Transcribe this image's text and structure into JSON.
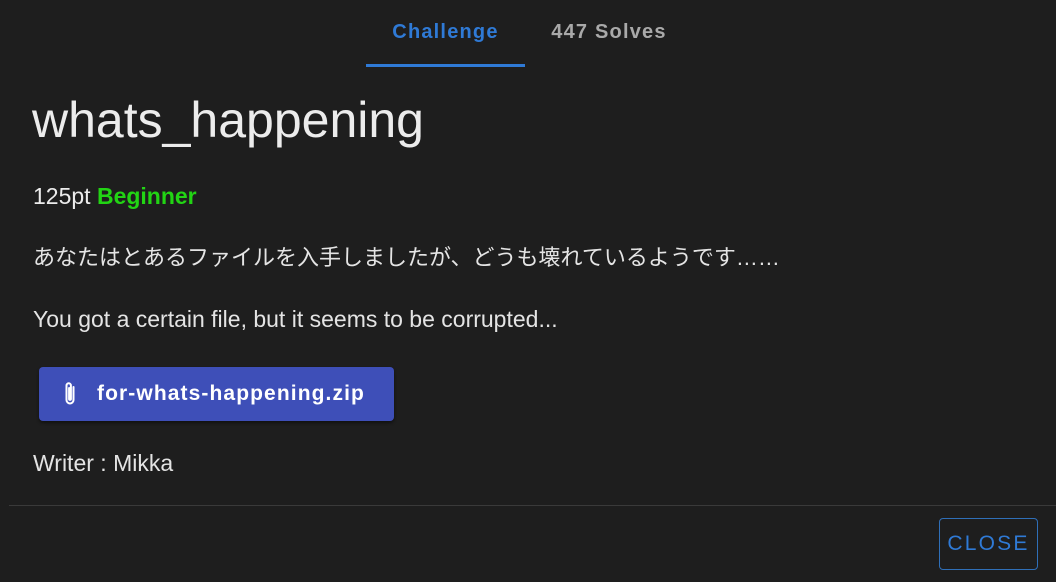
{
  "tabs": {
    "challenge_label": "Challenge",
    "solves_label": "447 Solves",
    "active": "Challenge"
  },
  "challenge": {
    "title": "whats_happening",
    "points": "125pt",
    "difficulty": "Beginner",
    "description_ja": "あなたはとあるファイルを入手しましたが、どうも壊れているようです……",
    "description_en": "You got a certain file, but it seems to be corrupted...",
    "attachment": {
      "icon": "paperclip-icon",
      "filename": "for-whats-happening.zip"
    },
    "writer": "Writer : Mikka"
  },
  "footer": {
    "close_label": "CLOSE"
  },
  "colors": {
    "background": "#1e1e1e",
    "accent": "#2f7ad6",
    "difficulty": "#22d414",
    "button": "#3e4fb8"
  }
}
